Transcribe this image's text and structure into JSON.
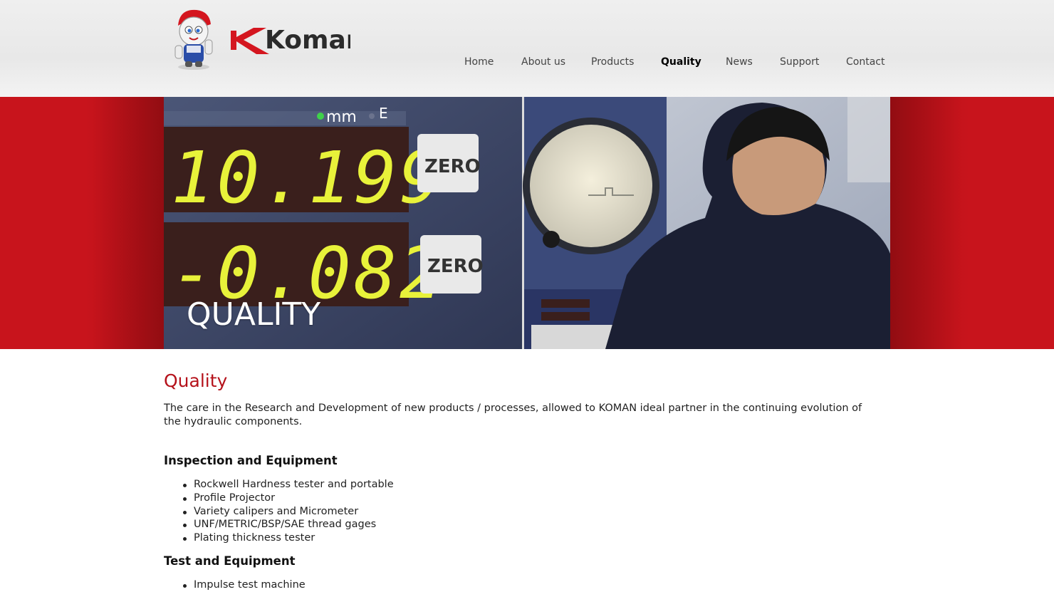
{
  "brand": {
    "name": "KOMAN",
    "logo_text": "Koman",
    "mascot_icon": "mascot-icon",
    "brand_color": "#c8141c"
  },
  "nav": {
    "items": [
      {
        "label": "Home",
        "active": false
      },
      {
        "label": "About us",
        "active": false
      },
      {
        "label": "Products",
        "active": false
      },
      {
        "label": "Quality",
        "active": true
      },
      {
        "label": "News",
        "active": false
      },
      {
        "label": "Support",
        "active": false
      },
      {
        "label": "Contact",
        "active": false
      }
    ]
  },
  "banner": {
    "title": "QUALITY",
    "readout_unit_mm": "mm",
    "readout_unit_e": "E",
    "readout_top": "10.199",
    "readout_bottom": "-0.082",
    "zero_label": "ZERO"
  },
  "main": {
    "title": "Quality",
    "intro": "The care in the Research and Development of new products / processes, allowed to KOMAN ideal partner in the continuing evolution of the hydraulic components.",
    "sections": [
      {
        "title": "Inspection and Equipment",
        "items": [
          "Rockwell Hardness tester and portable",
          "Profile Projector",
          "Variety calipers and Micrometer",
          "UNF/METRIC/BSP/SAE thread gages",
          "Plating thickness tester"
        ]
      },
      {
        "title": "Test and Equipment",
        "items": [
          "Impulse test machine"
        ]
      }
    ]
  },
  "colors": {
    "accent_red": "#c8141c",
    "title_red": "#b5121b"
  }
}
